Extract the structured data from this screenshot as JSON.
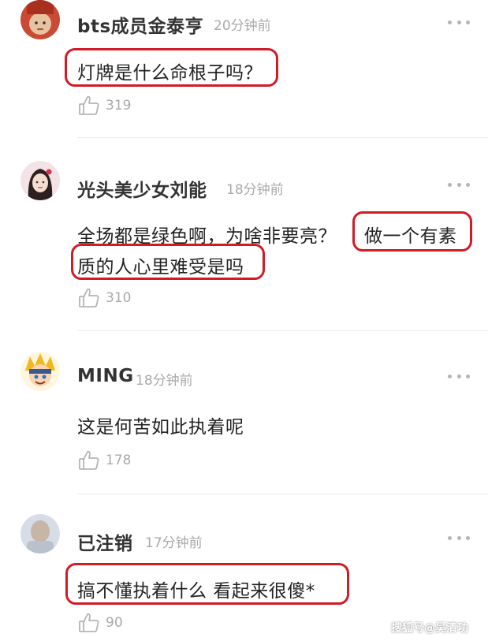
{
  "comments": [
    {
      "username": "bts成员金泰亨",
      "time": "20分钟前",
      "text_line1": "灯牌是什么命根子吗？",
      "likes": "319",
      "avatar_icon": "avatar-man-icon"
    },
    {
      "username": "光头美少女刘能",
      "time": "18分钟前",
      "text_line1_part1": "全场都是绿色啊，为啥非要亮？",
      "text_line1_part2": "做一个有素",
      "text_line2": "质的人心里难受是吗",
      "likes": "310",
      "avatar_icon": "avatar-woman-icon"
    },
    {
      "username": "MING",
      "time": "18分钟前",
      "text_line1": "这是何苦如此执着呢",
      "likes": "178",
      "avatar_icon": "avatar-cartoon-icon"
    },
    {
      "username": "已注销",
      "time": "17分钟前",
      "text_line1": "搞不懂执着什么 看起来很傻*",
      "likes": "90",
      "avatar_icon": "avatar-blurred-icon"
    }
  ],
  "watermark": "搜狐号@吴清功",
  "colors": {
    "highlight": "#d11b25",
    "muted": "#aaaaaa",
    "text": "#222222"
  }
}
